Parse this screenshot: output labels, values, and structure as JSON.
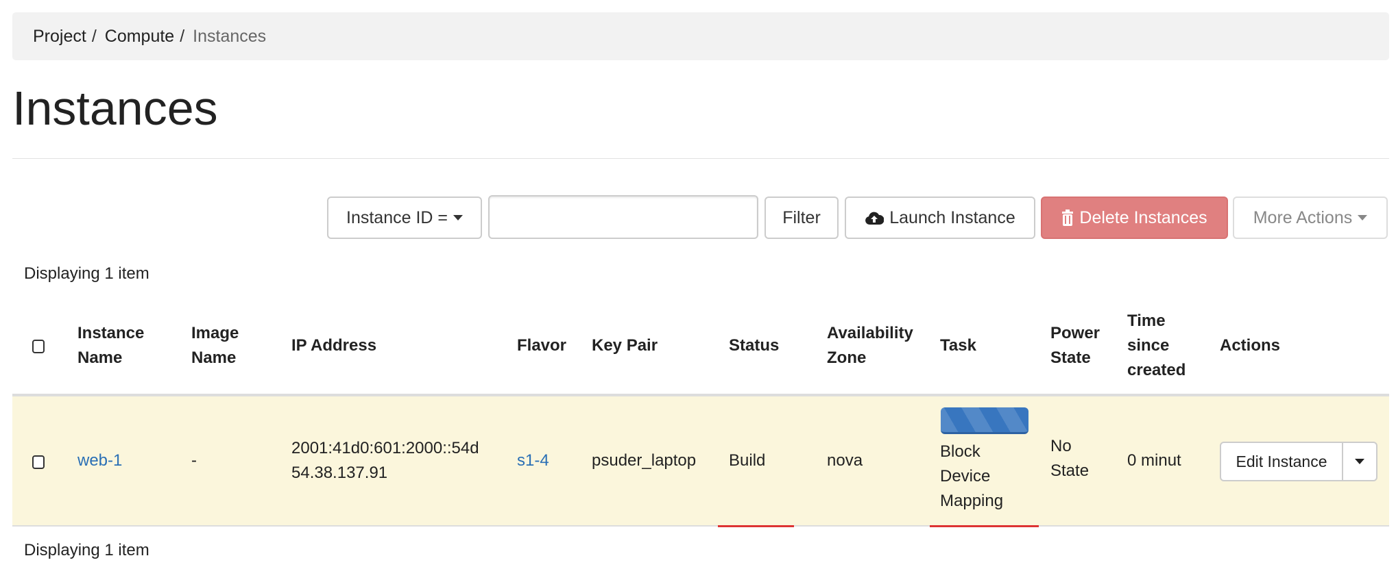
{
  "breadcrumb": {
    "items": [
      "Project",
      "Compute"
    ],
    "current": "Instances",
    "separator": "/"
  },
  "page_title": "Instances",
  "toolbar": {
    "filter_field": "Instance ID =",
    "filter_value": "",
    "filter_label": "Filter",
    "launch_label": "Launch Instance",
    "delete_label": "Delete Instances",
    "more_label": "More Actions"
  },
  "table": {
    "count_top": "Displaying 1 item",
    "count_bottom": "Displaying 1 item",
    "columns": [
      [
        "Instance",
        "Name"
      ],
      [
        "Image",
        "Name"
      ],
      [
        "IP Address"
      ],
      [
        "Flavor"
      ],
      [
        "Key Pair"
      ],
      [
        "Status"
      ],
      [
        "Availability",
        "Zone"
      ],
      [
        "Task"
      ],
      [
        "Power",
        "State"
      ],
      [
        "Time",
        "since",
        "created"
      ],
      [
        "Actions"
      ]
    ],
    "rows": [
      {
        "instance_name": "web-1",
        "image_name": "-",
        "ip": [
          "2001:41d0:601:2000::54d",
          "54.38.137.91"
        ],
        "flavor": "s1-4",
        "key_pair": "psuder_laptop",
        "status": "Build",
        "zone": "nova",
        "task": [
          "Block",
          "Device",
          "Mapping"
        ],
        "power": [
          "No",
          "State"
        ],
        "time": "0 minut",
        "action": "Edit Instance"
      }
    ]
  },
  "colors": {
    "accent": "#2a6fb5",
    "danger": "#e08080",
    "row_highlight": "#fbf6dc",
    "progress": "#3876bf"
  }
}
